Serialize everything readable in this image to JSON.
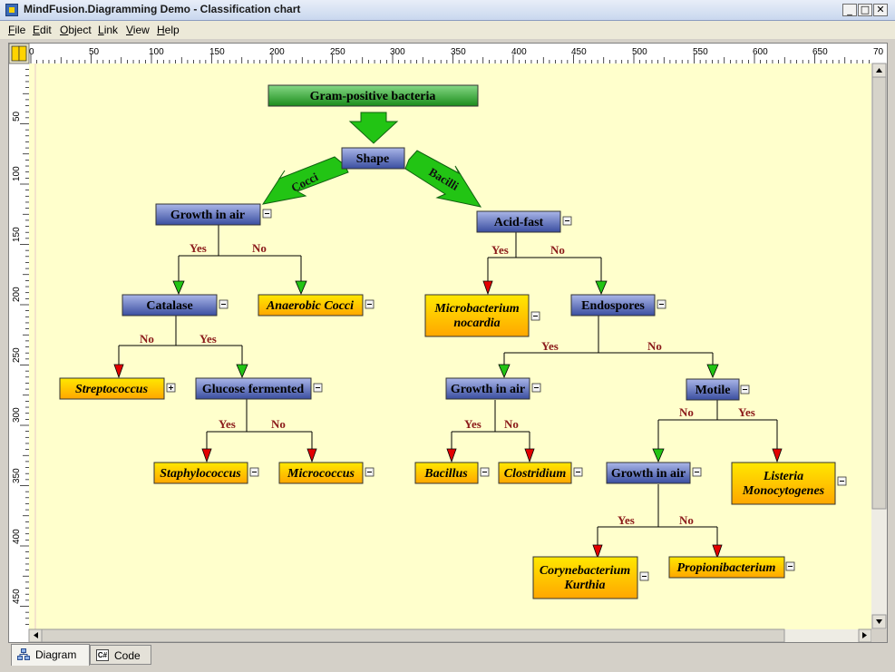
{
  "window": {
    "title": "MindFusion.Diagramming Demo - Classification chart",
    "minimize_glyph": "_",
    "maximize_glyph": "□",
    "close_glyph": "✕"
  },
  "menu": [
    "File",
    "Edit",
    "Object",
    "Link",
    "View",
    "Help"
  ],
  "ruler": {
    "h_ticks": [
      "0",
      "50",
      "100",
      "150",
      "200",
      "250",
      "300",
      "350",
      "400",
      "450",
      "500",
      "550",
      "600",
      "650",
      "70"
    ],
    "v_ticks": [
      "50",
      "100",
      "150",
      "200",
      "250",
      "300",
      "350",
      "400",
      "450"
    ]
  },
  "nodes": {
    "root": "Gram-positive bacteria",
    "shape": "Shape",
    "growth_air_1": "Growth in air",
    "acid_fast": "Acid-fast",
    "catalase": "Catalase",
    "anaerobic_cocci": "Anaerobic Cocci",
    "microbacterium": [
      "Microbacterium",
      "nocardia"
    ],
    "endospores": "Endospores",
    "streptococcus": "Streptococcus",
    "glucose": "Glucose fermented",
    "growth_air_2": "Growth in air",
    "motile": "Motile",
    "staphylococcus": "Staphylococcus",
    "micrococcus": "Micrococcus",
    "bacillus": "Bacillus",
    "clostridium": "Clostridium",
    "growth_air_3": "Growth in air",
    "listeria": [
      "Listeria",
      "Monocytogenes"
    ],
    "corynebacterium": [
      "Corynebacterium",
      "Kurthia"
    ],
    "propionibacterium": "Propionibacterium"
  },
  "arrow_labels": {
    "cocci": "Cocci",
    "bacilli": "Bacilli"
  },
  "edge_labels": {
    "yes": "Yes",
    "no": "No"
  },
  "tabs": [
    {
      "label": "Diagram",
      "icon": "diagram-icon",
      "active": true
    },
    {
      "label": "Code",
      "icon": "csharp-icon",
      "active": false,
      "badge": "C#"
    }
  ],
  "colors": {
    "canvas_bg": "#ffffcc",
    "blue_node_top": "#a9b5e6",
    "blue_node_bottom": "#3b4fa2",
    "gold_node_top": "#ffe600",
    "gold_node_bottom": "#ffa800",
    "green_node_top": "#7fd37f",
    "green_node_bottom": "#1e8f1e",
    "arrow_green": "#22c414",
    "arrowhead_red": "#e30000",
    "label_dark_red": "#8b1a1a"
  }
}
